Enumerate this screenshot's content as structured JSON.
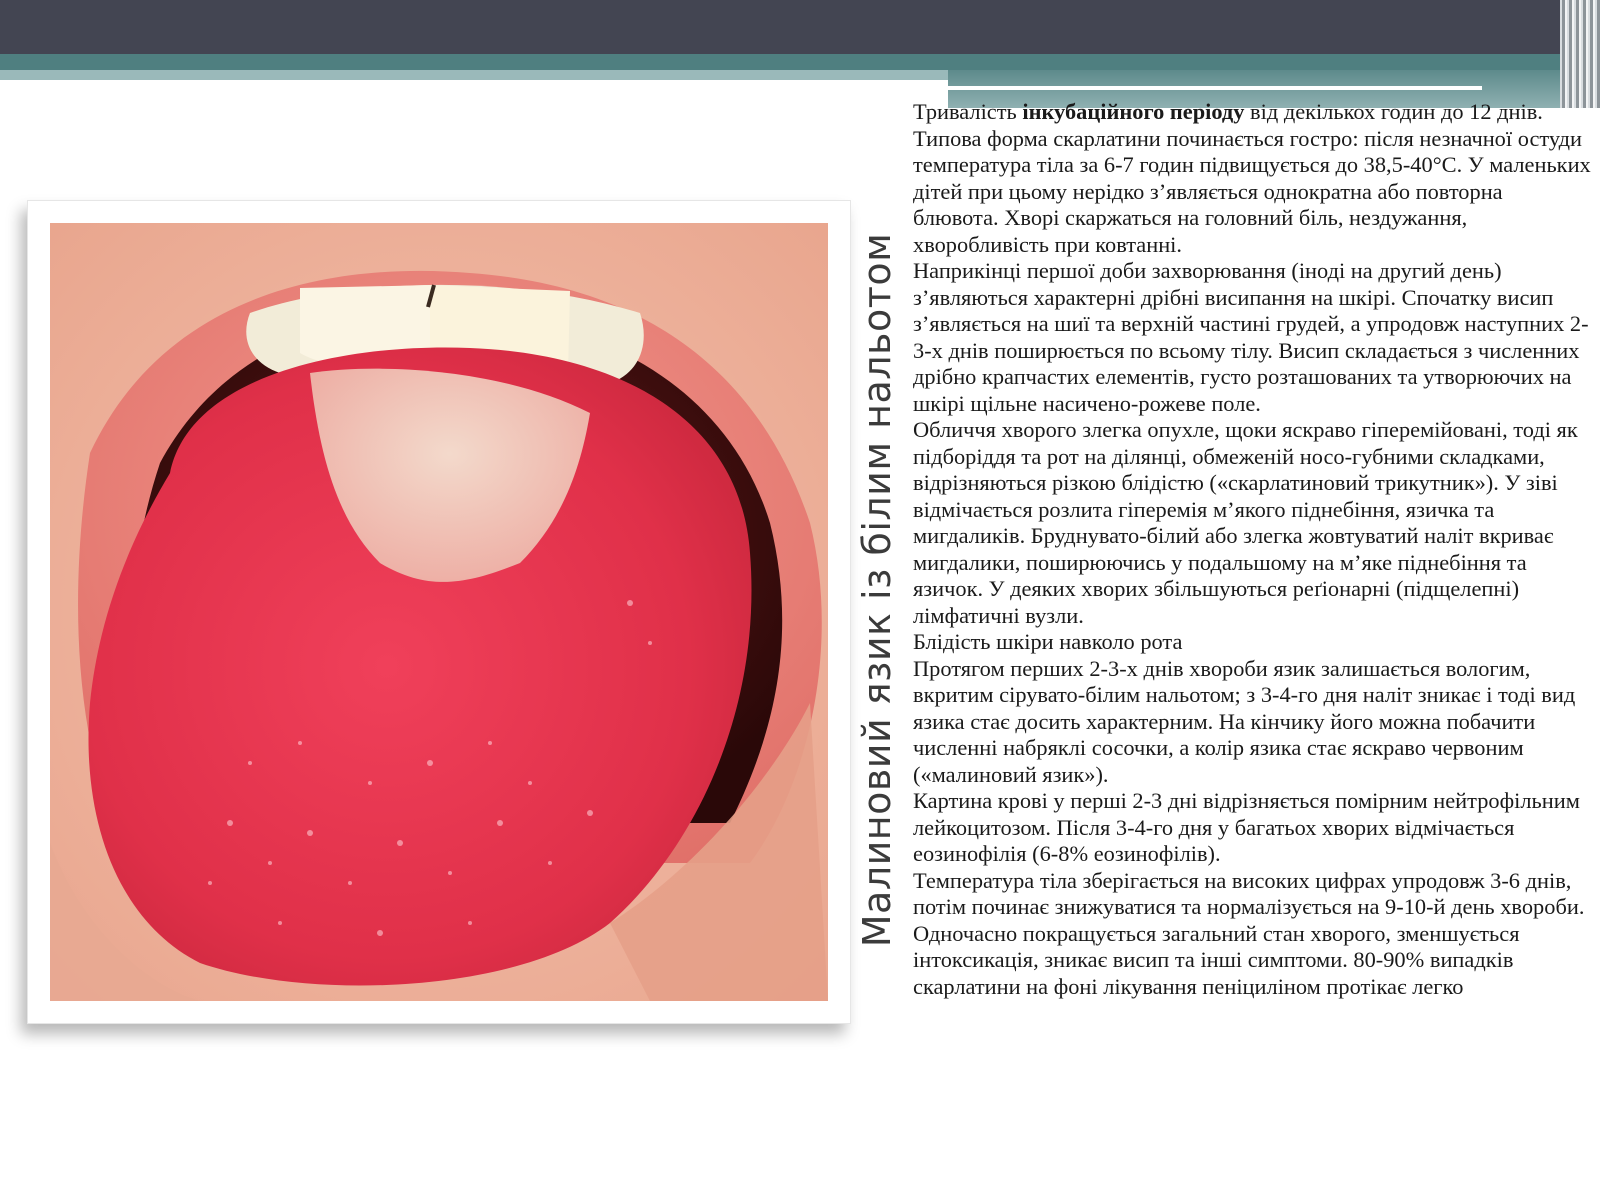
{
  "caption": "Малиновий язик із білим нальотом",
  "image": {
    "subject": "tongue-photo"
  },
  "paragraphs": [
    {
      "before": "Тривалість ",
      "bold": "інкубаційного періоду",
      "after": " від декількох годин до 12 днів. Типова форма скарлатини починається гостро: після незначної остуди температура тіла за 6-7 годин підвищується до 38,5-40°С. У маленьких дітей при цьому нерідко з’являється однократна або повторна блювота. Хворі скаржаться на головний біль, нездужання, хворобливість при ковтанні."
    },
    {
      "text": "Наприкінці першої доби захворювання (іноді на другий день) з’являються характерні дрібні висипання на шкірі. Спочатку висип з’являється на шиї та верхній частині грудей, а упродовж наступних 2-3-х днів поширюється по всьому тілу. Висип складається з численних дрібно крапчастих елементів, густо розташованих та утворюючих на шкірі щільне насичено-рожеве поле."
    },
    {
      "text": "Обличчя хворого злегка опухле, щоки яскраво гіперемійовані, тоді як підборіддя та рот на ділянці, обмеженій носо-губними складками, відрізняються різкою блідістю («скарлатиновий трикутник»). У зіві відмічається розлита гіперемія м’якого піднебіння, язичка та мигдаликів. Бруднувато-білий або злегка жовтуватий наліт вкриває мигдалики, поширюючись у подальшому на м’яке піднебіння та язичок. У деяких хворих збільшуються реґіонарні (підщелепні) лімфатичні вузли."
    },
    {
      "text": "Блідість шкіри навколо рота"
    },
    {
      "text": "Протягом перших 2-3-х днів хвороби язик залишається вологим, вкритим сірувато-білим нальотом; з 3-4-го дня наліт зникає і тоді вид язика стає досить характерним. На кінчику його можна побачити численні набряклі сосочки, а колір язика стає яскраво червоним («малиновий язик»)."
    },
    {
      "text": "Картина крові у перші 2-3 дні відрізняється помірним нейтрофільним лейкоцитозом. Після 3-4-го дня у багатьох хворих відмічається еозинофілія (6-8% еозинофілів)."
    },
    {
      "text": "Температура тіла зберігається на високих цифрах упродовж 3-6 днів, потім починає знижуватися та нормалізується на 9-10-й день хвороби. Одночасно покращується загальний стан хворого, зменшується інтоксикація, зникає висип та інші симптоми. 80-90% випадків скарлатини на фоні лікування пеніциліном протікає легко"
    }
  ],
  "colors": {
    "header_dark": "#434552",
    "header_teal": "#4f7f80",
    "header_light": "#9ab9ba",
    "text": "#1a1a1a",
    "caption": "#3b3b3b"
  }
}
